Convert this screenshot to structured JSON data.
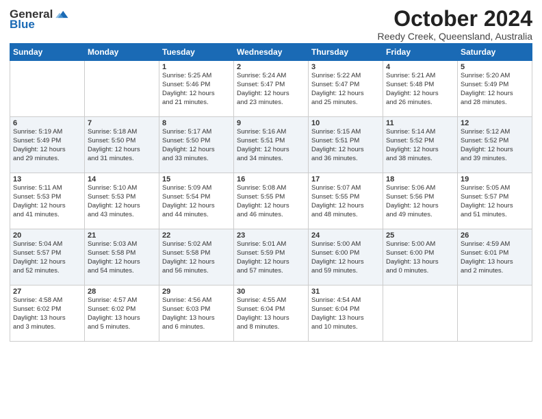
{
  "logo": {
    "general": "General",
    "blue": "Blue"
  },
  "title": "October 2024",
  "subtitle": "Reedy Creek, Queensland, Australia",
  "weekdays": [
    "Sunday",
    "Monday",
    "Tuesday",
    "Wednesday",
    "Thursday",
    "Friday",
    "Saturday"
  ],
  "weeks": [
    [
      {
        "day": "",
        "content": ""
      },
      {
        "day": "",
        "content": ""
      },
      {
        "day": "1",
        "content": "Sunrise: 5:25 AM\nSunset: 5:46 PM\nDaylight: 12 hours\nand 21 minutes."
      },
      {
        "day": "2",
        "content": "Sunrise: 5:24 AM\nSunset: 5:47 PM\nDaylight: 12 hours\nand 23 minutes."
      },
      {
        "day": "3",
        "content": "Sunrise: 5:22 AM\nSunset: 5:47 PM\nDaylight: 12 hours\nand 25 minutes."
      },
      {
        "day": "4",
        "content": "Sunrise: 5:21 AM\nSunset: 5:48 PM\nDaylight: 12 hours\nand 26 minutes."
      },
      {
        "day": "5",
        "content": "Sunrise: 5:20 AM\nSunset: 5:49 PM\nDaylight: 12 hours\nand 28 minutes."
      }
    ],
    [
      {
        "day": "6",
        "content": "Sunrise: 5:19 AM\nSunset: 5:49 PM\nDaylight: 12 hours\nand 29 minutes."
      },
      {
        "day": "7",
        "content": "Sunrise: 5:18 AM\nSunset: 5:50 PM\nDaylight: 12 hours\nand 31 minutes."
      },
      {
        "day": "8",
        "content": "Sunrise: 5:17 AM\nSunset: 5:50 PM\nDaylight: 12 hours\nand 33 minutes."
      },
      {
        "day": "9",
        "content": "Sunrise: 5:16 AM\nSunset: 5:51 PM\nDaylight: 12 hours\nand 34 minutes."
      },
      {
        "day": "10",
        "content": "Sunrise: 5:15 AM\nSunset: 5:51 PM\nDaylight: 12 hours\nand 36 minutes."
      },
      {
        "day": "11",
        "content": "Sunrise: 5:14 AM\nSunset: 5:52 PM\nDaylight: 12 hours\nand 38 minutes."
      },
      {
        "day": "12",
        "content": "Sunrise: 5:12 AM\nSunset: 5:52 PM\nDaylight: 12 hours\nand 39 minutes."
      }
    ],
    [
      {
        "day": "13",
        "content": "Sunrise: 5:11 AM\nSunset: 5:53 PM\nDaylight: 12 hours\nand 41 minutes."
      },
      {
        "day": "14",
        "content": "Sunrise: 5:10 AM\nSunset: 5:53 PM\nDaylight: 12 hours\nand 43 minutes."
      },
      {
        "day": "15",
        "content": "Sunrise: 5:09 AM\nSunset: 5:54 PM\nDaylight: 12 hours\nand 44 minutes."
      },
      {
        "day": "16",
        "content": "Sunrise: 5:08 AM\nSunset: 5:55 PM\nDaylight: 12 hours\nand 46 minutes."
      },
      {
        "day": "17",
        "content": "Sunrise: 5:07 AM\nSunset: 5:55 PM\nDaylight: 12 hours\nand 48 minutes."
      },
      {
        "day": "18",
        "content": "Sunrise: 5:06 AM\nSunset: 5:56 PM\nDaylight: 12 hours\nand 49 minutes."
      },
      {
        "day": "19",
        "content": "Sunrise: 5:05 AM\nSunset: 5:57 PM\nDaylight: 12 hours\nand 51 minutes."
      }
    ],
    [
      {
        "day": "20",
        "content": "Sunrise: 5:04 AM\nSunset: 5:57 PM\nDaylight: 12 hours\nand 52 minutes."
      },
      {
        "day": "21",
        "content": "Sunrise: 5:03 AM\nSunset: 5:58 PM\nDaylight: 12 hours\nand 54 minutes."
      },
      {
        "day": "22",
        "content": "Sunrise: 5:02 AM\nSunset: 5:58 PM\nDaylight: 12 hours\nand 56 minutes."
      },
      {
        "day": "23",
        "content": "Sunrise: 5:01 AM\nSunset: 5:59 PM\nDaylight: 12 hours\nand 57 minutes."
      },
      {
        "day": "24",
        "content": "Sunrise: 5:00 AM\nSunset: 6:00 PM\nDaylight: 12 hours\nand 59 minutes."
      },
      {
        "day": "25",
        "content": "Sunrise: 5:00 AM\nSunset: 6:00 PM\nDaylight: 13 hours\nand 0 minutes."
      },
      {
        "day": "26",
        "content": "Sunrise: 4:59 AM\nSunset: 6:01 PM\nDaylight: 13 hours\nand 2 minutes."
      }
    ],
    [
      {
        "day": "27",
        "content": "Sunrise: 4:58 AM\nSunset: 6:02 PM\nDaylight: 13 hours\nand 3 minutes."
      },
      {
        "day": "28",
        "content": "Sunrise: 4:57 AM\nSunset: 6:02 PM\nDaylight: 13 hours\nand 5 minutes."
      },
      {
        "day": "29",
        "content": "Sunrise: 4:56 AM\nSunset: 6:03 PM\nDaylight: 13 hours\nand 6 minutes."
      },
      {
        "day": "30",
        "content": "Sunrise: 4:55 AM\nSunset: 6:04 PM\nDaylight: 13 hours\nand 8 minutes."
      },
      {
        "day": "31",
        "content": "Sunrise: 4:54 AM\nSunset: 6:04 PM\nDaylight: 13 hours\nand 10 minutes."
      },
      {
        "day": "",
        "content": ""
      },
      {
        "day": "",
        "content": ""
      }
    ]
  ]
}
